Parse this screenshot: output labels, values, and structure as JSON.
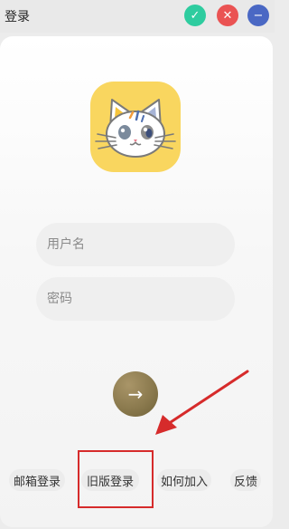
{
  "window": {
    "title": "登录",
    "buttons": {
      "confirm_glyph": "✓",
      "close_glyph": "✕",
      "minimize_glyph": "−"
    }
  },
  "login": {
    "username_placeholder": "用户名",
    "password_placeholder": "密码",
    "submit_glyph": "→"
  },
  "footer_links": [
    "邮箱登录",
    "旧版登录",
    "如何加入",
    "反馈"
  ],
  "colors": {
    "accent_green": "#2ecc9f",
    "close_red": "#ea5353",
    "minimize_blue": "#4a68c4",
    "logo_yellow": "#f9d65f",
    "submit_brown": "#8b7a4e",
    "annotation_red": "#d62b2b"
  }
}
